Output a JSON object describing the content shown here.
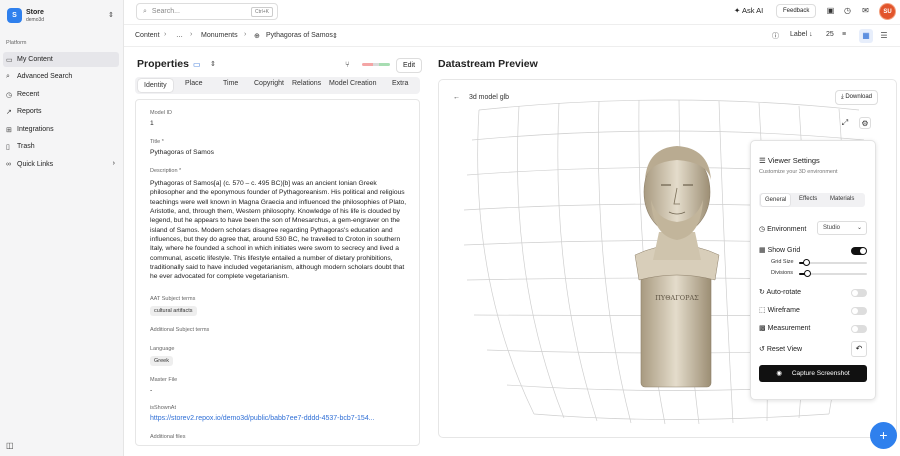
{
  "sidebar": {
    "logo": "S",
    "store_title": "Store",
    "store_sub": "demo3d",
    "section": "Platform",
    "items": [
      {
        "label": "My Content",
        "icon": "folder-icon"
      },
      {
        "label": "Advanced Search",
        "icon": "search-icon"
      },
      {
        "label": "Recent",
        "icon": "clock-icon"
      },
      {
        "label": "Reports",
        "icon": "chart-icon"
      },
      {
        "label": "Integrations",
        "icon": "plug-icon"
      },
      {
        "label": "Trash",
        "icon": "trash-icon"
      },
      {
        "label": "Quick Links",
        "icon": "link-icon"
      }
    ]
  },
  "topbar": {
    "search_placeholder": "Search...",
    "search_kbd": "Ctrl+K",
    "ask_ai": "Ask AI",
    "feedback": "Feedback",
    "avatar": "SU"
  },
  "breadcrumb": {
    "items": [
      "Content",
      "…",
      "Monuments",
      "Pythagoras of Samos"
    ],
    "label_sort": "Label",
    "count": "25"
  },
  "properties": {
    "title": "Properties",
    "edit": "Edit",
    "tabs": [
      "Identity",
      "Place",
      "Time",
      "Copyright",
      "Relations",
      "Model Creation",
      "Extra"
    ],
    "fields": {
      "model_id_label": "Model ID",
      "model_id": "1",
      "title_label": "Title *",
      "title": "Pythagoras of Samos",
      "description_label": "Description *",
      "description": "Pythagoras of Samos[a] (c. 570 – c. 495 BC)[b] was an ancient Ionian Greek philosopher and the eponymous founder of Pythagoreanism. His political and religious teachings were well known in Magna Graecia and influenced the philosophies of Plato, Aristotle, and, through them, Western philosophy. Knowledge of his life is clouded by legend, but he appears to have been the son of Mnesarchus, a gem-engraver on the island of Samos. Modern scholars disagree regarding Pythagoras's education and influences, but they do agree that, around 530 BC, he travelled to Croton in southern Italy, where he founded a school in which initiates were sworn to secrecy and lived a communal, ascetic lifestyle. This lifestyle entailed a number of dietary prohibitions, traditionally said to have included vegetarianism, although modern scholars doubt that he ever advocated for complete vegetarianism.",
      "aat_label": "AAT Subject terms",
      "aat_tag": "cultural artifacts",
      "additional_subject_label": "Additional Subject terms",
      "language_label": "Language",
      "language_tag": "Greek",
      "master_file_label": "Master File",
      "master_file": "-",
      "isshownat_label": "isShownAt",
      "isshownat": "https://storev2.repox.io/demo3d/public/babb7ee7-dddd-4537-bcb7-154...",
      "additional_files_label": "Additional files"
    }
  },
  "preview": {
    "title": "Datastream Preview",
    "model_label": "3d model glb",
    "download": "Download",
    "viewer": {
      "title": "Viewer Settings",
      "subtitle": "Customize your 3D environment",
      "tabs": [
        "General",
        "Effects",
        "Materials"
      ],
      "environment_label": "Environment",
      "environment_value": "Studio",
      "show_grid": "Show Grid",
      "grid_size": "Grid Size",
      "grid_size_value": 0.1,
      "divisions": "Divisions",
      "divisions_value": 0.12,
      "auto_rotate": "Auto-rotate",
      "wireframe": "Wireframe",
      "measurement": "Measurement",
      "reset_view": "Reset View",
      "capture": "Capture Screenshot",
      "toggles": {
        "show_grid": true,
        "auto_rotate": false,
        "wireframe": false,
        "measurement": false
      }
    },
    "bust_inscription": "ΠΥΘΑΓΟΡΑΣ"
  },
  "colors": {
    "accent": "#2f80ed",
    "avatar": "#e2552c",
    "link": "#2f6fd6"
  }
}
